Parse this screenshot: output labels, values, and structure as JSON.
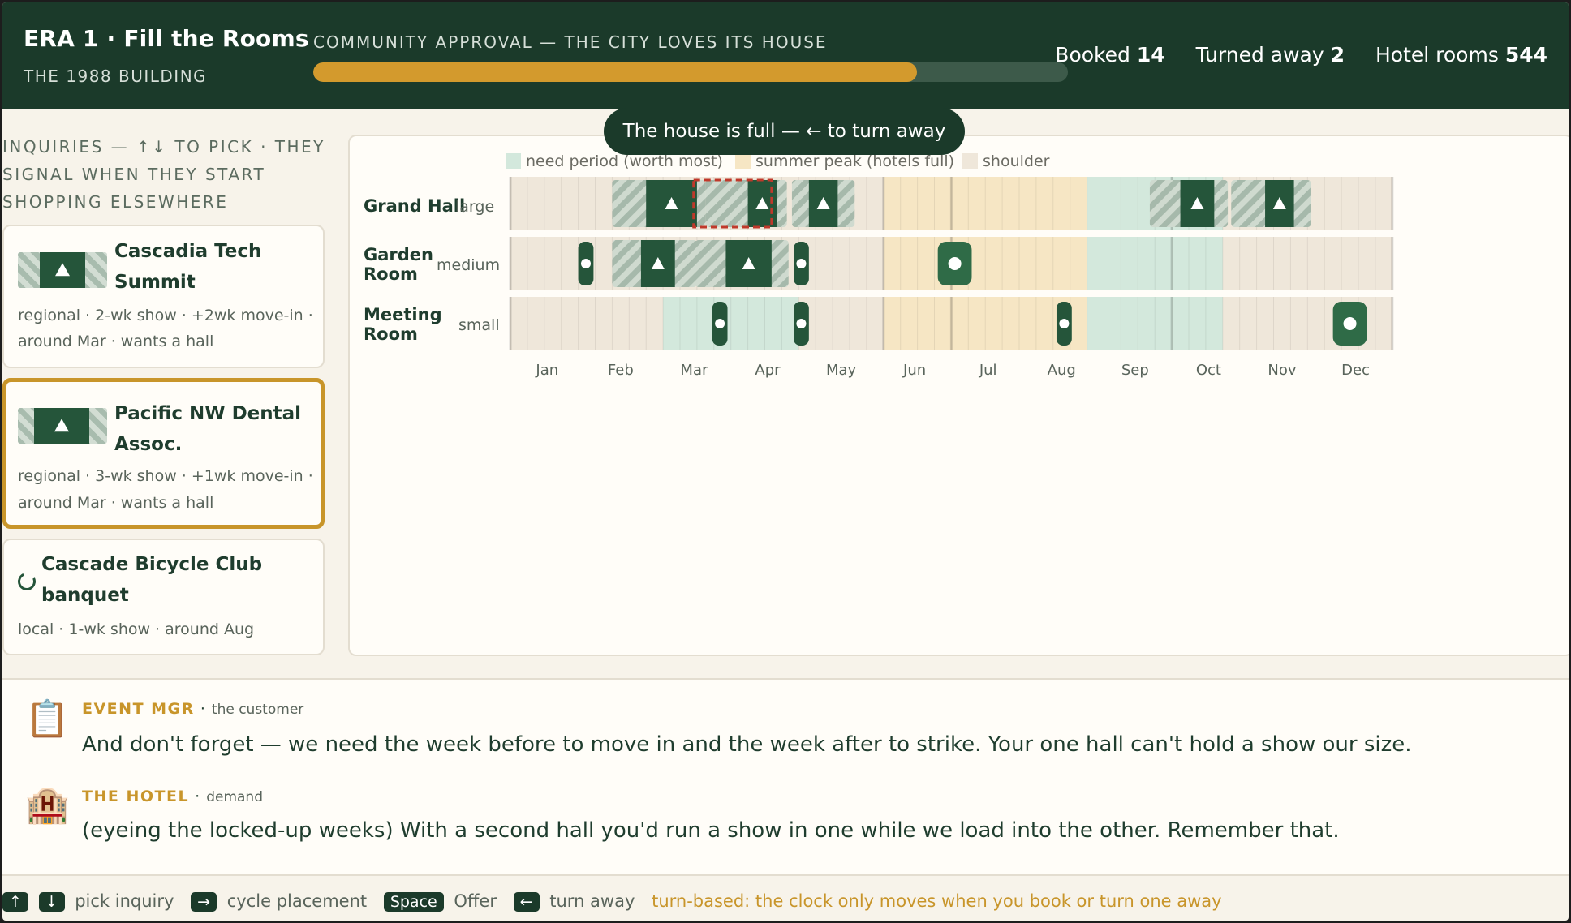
{
  "header": {
    "era_title": "ERA 1 · Fill the Rooms",
    "building": "THE 1988 BUILDING",
    "approval_label": "COMMUNITY APPROVAL — THE CITY LOVES ITS HOUSE",
    "approval_fraction": 0.8,
    "stats": {
      "booked_label": "Booked",
      "booked": "14",
      "turned_away_label": "Turned away",
      "turned_away": "2",
      "hotel_rooms_label": "Hotel rooms",
      "hotel_rooms": "544"
    }
  },
  "toast": "The house is full — ← to turn away",
  "inquiries": {
    "heading": "INQUIRIES — ↑↓ TO PICK · THEY SIGNAL WHEN THEY START SHOPPING ELSEWHERE",
    "items": [
      {
        "name": "Cascadia Tech Summit",
        "details": [
          "regional · 2-wk show · +2wk move-in ·",
          "around Mar · wants a hall"
        ],
        "icon": "hall-block-icon",
        "selected": false
      },
      {
        "name": "Pacific NW Dental Assoc.",
        "details": [
          "regional · 3-wk show · +1wk move-in ·",
          "around Mar · wants a hall"
        ],
        "icon": "hall-block-icon",
        "selected": true
      },
      {
        "name": "Cascade Bicycle Club banquet",
        "details": [
          "local · 1-wk show · around Aug"
        ],
        "icon": "crescent-icon",
        "selected": false
      }
    ]
  },
  "calendar": {
    "legend": [
      "need period (worth most)",
      "summer peak (hotels full)",
      "shoulder"
    ],
    "colors": {
      "need": "#d3e8dc",
      "peak": "#f6e6c4",
      "shoulder": "#efe7da",
      "booked": "#25553a",
      "move": "#9fb8a7",
      "accent": "#c8952a",
      "hold": "#c0392b"
    },
    "months": [
      "Jan",
      "Feb",
      "Mar",
      "Apr",
      "May",
      "Jun",
      "Jul",
      "Aug",
      "Sep",
      "Oct",
      "Nov",
      "Dec"
    ],
    "rows": [
      {
        "name": "Grand Hall",
        "size": "large"
      },
      {
        "name": "Garden Room",
        "size": "medium"
      },
      {
        "name": "Meeting Room",
        "size": "small"
      }
    ]
  },
  "dialogue": [
    {
      "speaker": "EVENT MGR",
      "role": "the customer",
      "icon": "clipboard-icon",
      "text": "And don't forget — we need the week before to move in and the week after to strike. Your one hall can't hold a show our size."
    },
    {
      "speaker": "THE HOTEL",
      "role": "demand",
      "icon": "hotel-icon",
      "text": "(eyeing the locked-up weeks) With a second hall you'd run a show in one while we load into the other. Remember that."
    }
  ],
  "footer": {
    "keys": [
      {
        "key": "↑",
        "label": ""
      },
      {
        "key": "↓",
        "label": "pick inquiry"
      },
      {
        "key": "→",
        "label": "cycle placement"
      },
      {
        "key": "Space",
        "label": "Offer"
      },
      {
        "key": "←",
        "label": "turn away"
      }
    ],
    "note": "turn-based: the clock only moves when you book or turn one away"
  }
}
